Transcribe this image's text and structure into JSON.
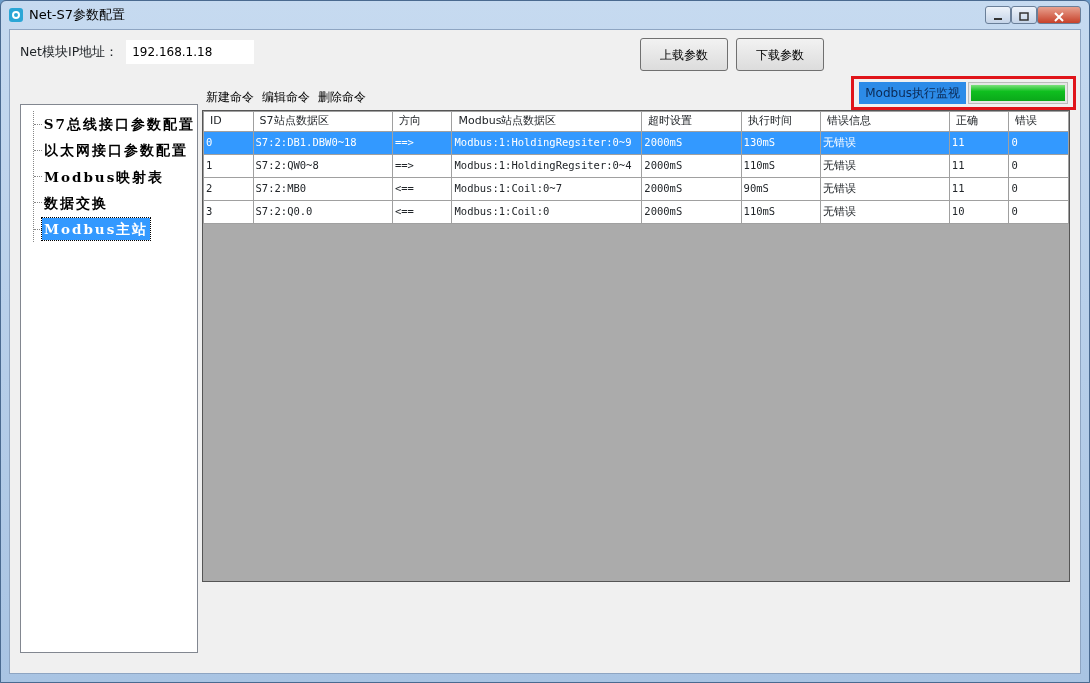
{
  "window": {
    "title": "Net-S7参数配置"
  },
  "ip": {
    "label": "Net模块IP地址：",
    "value": "192.168.1.18"
  },
  "buttons": [
    "上载参数",
    "下载参数"
  ],
  "tree": {
    "items": [
      {
        "label": "S7总线接口参数配置",
        "selected": false
      },
      {
        "label": "以太网接口参数配置",
        "selected": false
      },
      {
        "label": "Modbus映射表",
        "selected": false
      },
      {
        "label": "数据交换",
        "selected": false
      },
      {
        "label": "Modbus主站",
        "selected": true
      }
    ]
  },
  "toolbar": [
    "新建命令",
    "编辑命令",
    "删除命令"
  ],
  "monitor": {
    "label": "Modbus执行监视",
    "level": 1
  },
  "table": {
    "columns": [
      "ID",
      "S7站点数据区",
      "方向",
      "Modbus站点数据区",
      "超时设置",
      "执行时间",
      "错误信息",
      "正确",
      "错误"
    ],
    "rows": [
      {
        "selected": true,
        "cells": [
          "0",
          "S7:2:DB1.DBW0~18",
          "==>",
          "Modbus:1:HoldingRegsiter:0~9",
          "2000mS",
          "130mS",
          "无错误",
          "11",
          "0"
        ]
      },
      {
        "selected": false,
        "cells": [
          "1",
          "S7:2:QW0~8",
          "==>",
          "Modbus:1:HoldingRegsiter:0~4",
          "2000mS",
          "110mS",
          "无错误",
          "11",
          "0"
        ]
      },
      {
        "selected": false,
        "cells": [
          "2",
          "S7:2:MB0",
          "<==",
          "Modbus:1:Coil:0~7",
          "2000mS",
          "90mS",
          "无错误",
          "11",
          "0"
        ]
      },
      {
        "selected": false,
        "cells": [
          "3",
          "S7:2:Q0.0",
          "<==",
          "Modbus:1:Coil:0",
          "2000mS",
          "110mS",
          "无错误",
          "10",
          "0"
        ]
      }
    ]
  }
}
